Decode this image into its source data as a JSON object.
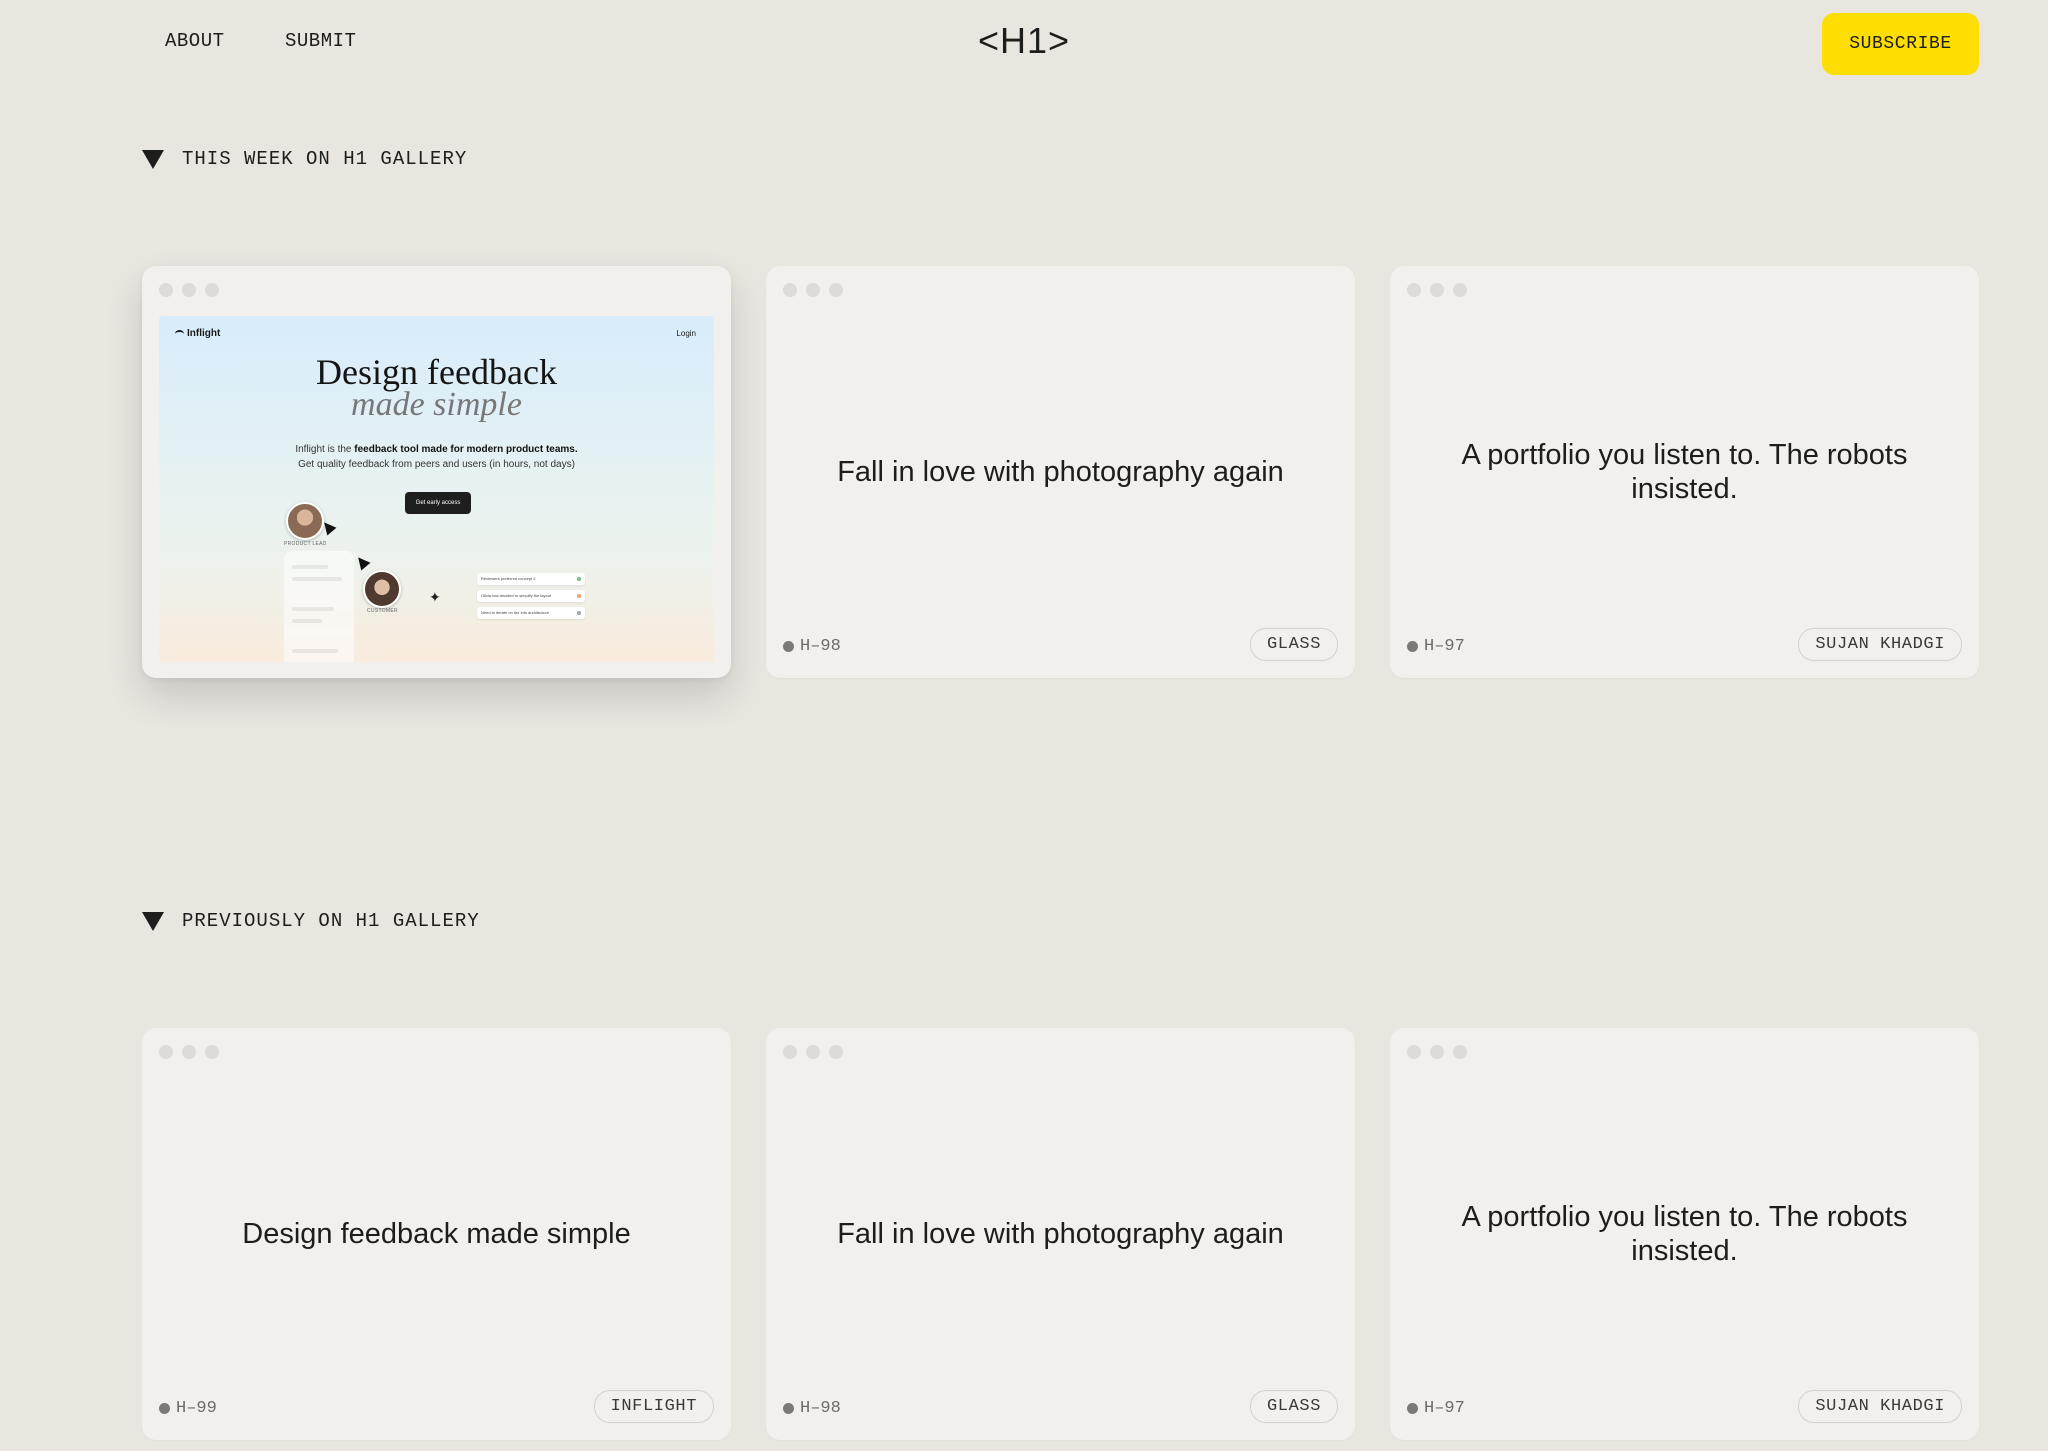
{
  "header": {
    "nav": [
      {
        "label": "ABOUT"
      },
      {
        "label": "SUBMIT"
      }
    ],
    "logo": "<H1>",
    "subscribe_label": "SUBSCRIBE",
    "subscribe_color": "#fedd00"
  },
  "sections": [
    {
      "heading": "THIS WEEK ON H1 GALLERY",
      "cards": [
        {
          "featured": true,
          "preview": {
            "brand": "Inflight",
            "login": "Login",
            "headline": "Design feedback",
            "headline_italic": "made simple",
            "sub_prefix": "Inflight is the ",
            "sub_bold": "feedback tool made for modern product teams.",
            "sub_line2": "Get quality feedback from peers and users (in hours, not days)",
            "cta": "Get early access",
            "avatar_label_1": "PRODUCT LEAD",
            "avatar_label_2": "CUSTOMER",
            "list": [
              "Reviewers preferred concept 2",
              "Olivia has decided to simplify the layout",
              "Need to iterate on the info architecture"
            ]
          }
        },
        {
          "title": "Fall in love with photography again",
          "id": "H–98",
          "tag": "GLASS"
        },
        {
          "title": "A portfolio you listen to. The robots insisted.",
          "id": "H–97",
          "tag": "SUJAN KHADGI"
        }
      ]
    },
    {
      "heading": "PREVIOUSLY ON H1 GALLERY",
      "cards": [
        {
          "title": "Design feedback made simple",
          "id": "H–99",
          "tag": "INFLIGHT"
        },
        {
          "title": "Fall in love with photography again",
          "id": "H–98",
          "tag": "GLASS"
        },
        {
          "title": "A portfolio you listen to. The robots insisted.",
          "id": "H–97",
          "tag": "SUJAN KHADGI"
        }
      ]
    }
  ]
}
